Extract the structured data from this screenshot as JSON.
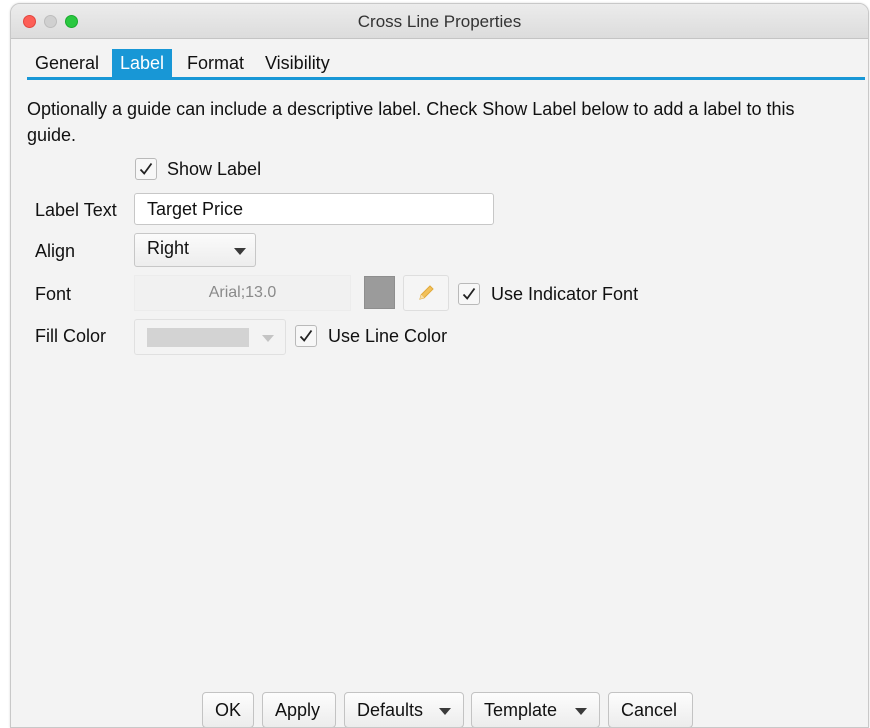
{
  "window": {
    "title": "Cross Line Properties",
    "accent_color": "#1897d6"
  },
  "tabs": [
    {
      "label": "General",
      "active": false
    },
    {
      "label": "Label",
      "active": true
    },
    {
      "label": "Format",
      "active": false
    },
    {
      "label": "Visibility",
      "active": false
    }
  ],
  "description": "Optionally a guide can include a descriptive label.  Check Show Label below to add a label to this guide.",
  "show_label": {
    "label": "Show Label",
    "checked": true
  },
  "label_text": {
    "label": "Label Text",
    "value": "Target Price"
  },
  "align": {
    "label": "Align",
    "value": "Right"
  },
  "font": {
    "label": "Font",
    "value": "Arial;13.0",
    "swatch_color": "#9b9b9b",
    "edit_icon": "pencil-icon",
    "use_indicator_font": {
      "label": "Use Indicator Font",
      "checked": true
    }
  },
  "fill_color": {
    "label": "Fill Color",
    "swatch_color": "#d3d3d3",
    "use_line_color": {
      "label": "Use Line Color",
      "checked": true
    }
  },
  "buttons": {
    "ok": "OK",
    "apply": "Apply",
    "defaults": "Defaults",
    "template": "Template",
    "cancel": "Cancel"
  }
}
